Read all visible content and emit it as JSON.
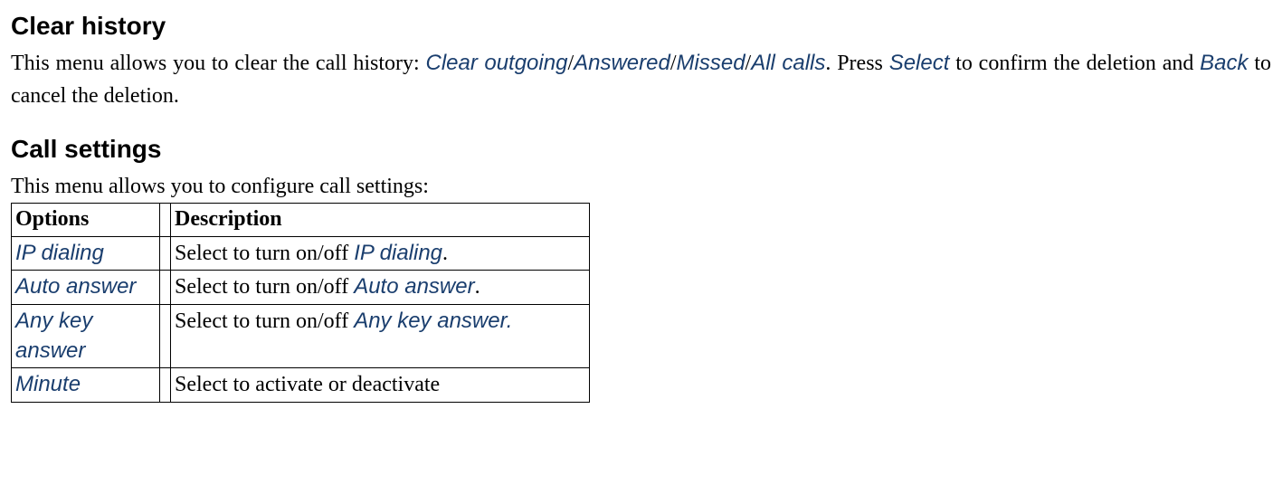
{
  "sections": {
    "clear_history": {
      "heading": "Clear history",
      "para_pre": "This menu allows you to clear the call history: ",
      "opt_outgoing": "Clear outgoing",
      "opt_answered": "Answered",
      "opt_missed": "Missed",
      "opt_all": "All calls",
      "slash": "/",
      "para_mid1": ". Press ",
      "btn_select": "Select",
      "para_mid2": " to confirm the deletion and    ",
      "btn_back": "Back",
      "para_end": " to cancel the deletion."
    },
    "call_settings": {
      "heading": "Call settings",
      "intro": "This menu allows you to configure call settings:",
      "table": {
        "header_options": "Options",
        "header_description": "Description",
        "rows": [
          {
            "option": "IP dialing",
            "desc_pre": "Select to turn on/off ",
            "desc_em": "IP dialing",
            "desc_post": "."
          },
          {
            "option": "Auto answer",
            "desc_pre": "Select to turn on/off ",
            "desc_em": "Auto answer",
            "desc_post": "."
          },
          {
            "option": "Any key answer",
            "desc_pre": "Select to turn on/off ",
            "desc_em": "Any key answer",
            "desc_post": "."
          },
          {
            "option": "Minute",
            "desc_pre": "Select to activate or deactivate",
            "desc_em": "",
            "desc_post": ""
          }
        ]
      }
    }
  }
}
